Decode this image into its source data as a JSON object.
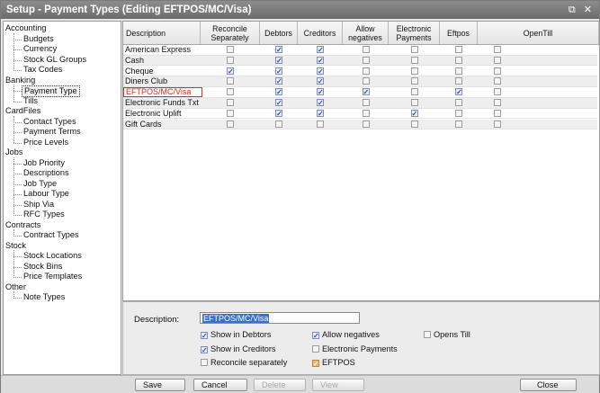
{
  "window": {
    "title": "Setup - Payment Types (Editing EFTPOS/MC/Visa)",
    "controls": [
      "⧉",
      "✕"
    ]
  },
  "sidebar": {
    "groups": [
      {
        "label": "Accounting",
        "items": [
          "Budgets",
          "Currency",
          "Stock GL Groups",
          "Tax Codes"
        ]
      },
      {
        "label": "Banking",
        "items": [
          "Payment Type",
          "Tills"
        ]
      },
      {
        "label": "CardFiles",
        "items": [
          "Contact Types",
          "Payment Terms",
          "Price Levels"
        ]
      },
      {
        "label": "Jobs",
        "items": [
          "Job Priority",
          "Descriptions",
          "Job Type",
          "Labour Type",
          "Ship Via",
          "RFC Types"
        ]
      },
      {
        "label": "Contracts",
        "items": [
          "Contract Types"
        ]
      },
      {
        "label": "Stock",
        "items": [
          "Stock Locations",
          "Stock Bins",
          "Price Templates"
        ]
      },
      {
        "label": "Other",
        "items": [
          "Note Types"
        ]
      }
    ],
    "selected": "Payment Type"
  },
  "grid": {
    "columns": [
      "Description",
      "Reconcile Separately",
      "Debtors",
      "Creditors",
      "Allow negatives",
      "Electronic Payments",
      "Eftpos",
      "OpenTill"
    ],
    "rows": [
      {
        "description": "American Express",
        "checks": [
          false,
          true,
          true,
          false,
          false,
          false,
          false
        ]
      },
      {
        "description": "Cash",
        "checks": [
          false,
          true,
          true,
          false,
          false,
          false,
          false
        ]
      },
      {
        "description": "Cheque",
        "checks": [
          true,
          true,
          true,
          false,
          false,
          false,
          false
        ]
      },
      {
        "description": "Diners Club",
        "checks": [
          false,
          true,
          true,
          false,
          false,
          false,
          false
        ]
      },
      {
        "description": "EFTPOS/MC/Visa",
        "checks": [
          false,
          true,
          true,
          true,
          false,
          true,
          false
        ]
      },
      {
        "description": "Electronic Funds Txt",
        "checks": [
          false,
          true,
          true,
          false,
          false,
          false,
          false
        ]
      },
      {
        "description": "Electronic Uplift",
        "checks": [
          false,
          true,
          true,
          false,
          true,
          false,
          false
        ]
      },
      {
        "description": "Gift Cards",
        "checks": [
          false,
          false,
          false,
          false,
          false,
          false,
          false
        ]
      }
    ],
    "selected_row": 4
  },
  "detail": {
    "description_label": "Description:",
    "description_value": "EFTPOS/MC/Visa",
    "options": {
      "show_in_debtors": {
        "label": "Show in Debtors",
        "checked": true
      },
      "show_in_creditors": {
        "label": "Show in Creditors",
        "checked": true
      },
      "reconcile_separately": {
        "label": "Reconcile separately",
        "checked": false
      },
      "allow_negatives": {
        "label": "Allow negatives",
        "checked": true
      },
      "electronic_payments": {
        "label": "Electronic Payments",
        "checked": false
      },
      "eftpos": {
        "label": "EFTPOS",
        "checked": true
      },
      "opens_till": {
        "label": "Opens Till",
        "checked": false
      }
    }
  },
  "buttons": {
    "save": "Save",
    "cancel": "Cancel",
    "delete": "Delete",
    "view": "View",
    "close": "Close"
  },
  "colors": {
    "titlebar": "#7b7b7b",
    "selected_text": "#d22222",
    "selection_highlight": "#3a6fd0",
    "eftpos_check": "#f7b36a"
  }
}
